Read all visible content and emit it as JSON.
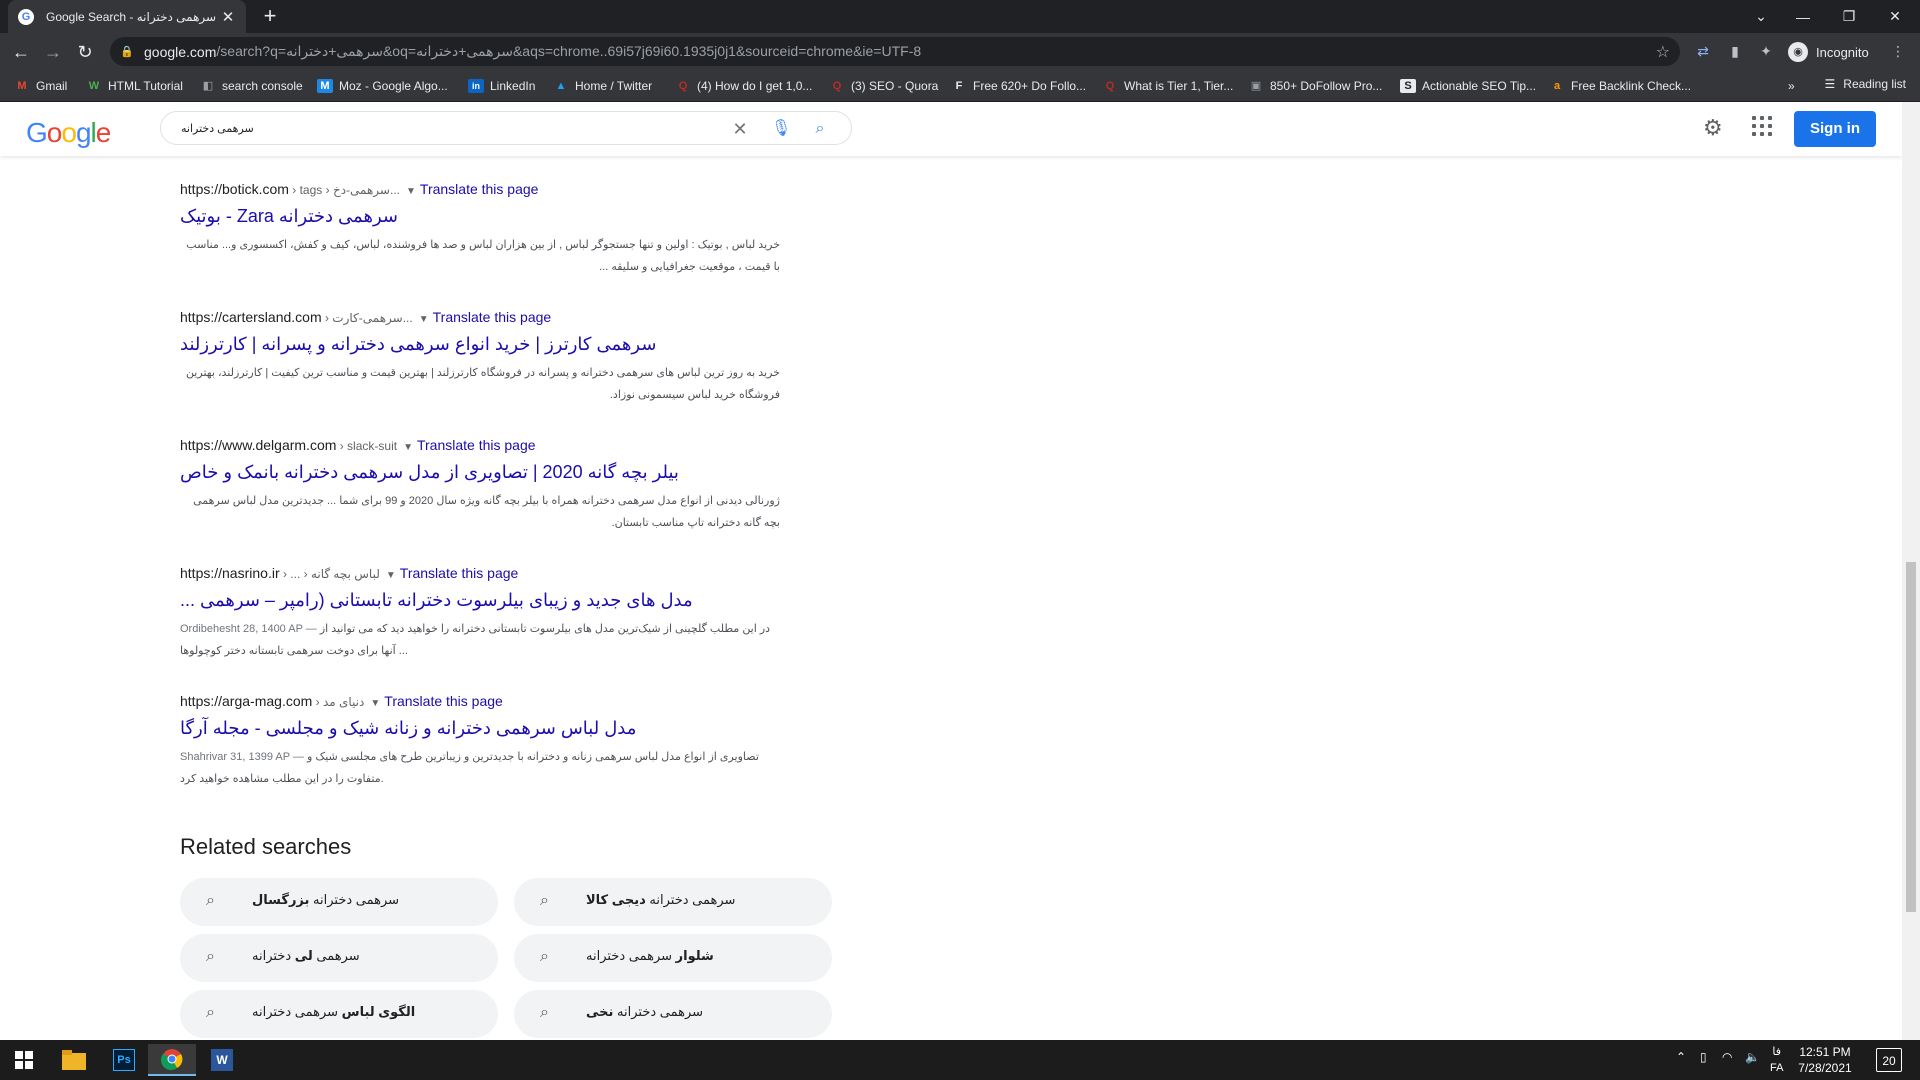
{
  "browser": {
    "tab_title": "Google Search - سرهمی دخترانه",
    "url_host": "google.com",
    "url_rest": "/search?q=سرهمی+دخترانه&oq=سرهمی+دخترانه&aqs=chrome..69i57j69i60.1935j0j1&sourceid=chrome&ie=UTF-8",
    "incognito_label": "Incognito",
    "reading_list": "Reading list",
    "bookmarks": [
      {
        "label": "Gmail",
        "icon": "M",
        "color": "#ea4335"
      },
      {
        "label": "HTML Tutorial",
        "icon": "W",
        "color": "#4caf50"
      },
      {
        "label": "search console",
        "icon": "◧",
        "color": "#9aa0a6"
      },
      {
        "label": "Moz - Google Algo...",
        "icon": "M",
        "color": "#1e88e5"
      },
      {
        "label": "LinkedIn",
        "icon": "in",
        "color": "#0a66c2"
      },
      {
        "label": "Home / Twitter",
        "icon": "🐦",
        "color": "#1da1f2"
      },
      {
        "label": "(4) How do I get 1,0...",
        "icon": "Q",
        "color": "#b92b27"
      },
      {
        "label": "(3) SEO - Quora",
        "icon": "Q",
        "color": "#b92b27"
      },
      {
        "label": "Free 620+ Do Follo...",
        "icon": "F",
        "color": "#e8eaed"
      },
      {
        "label": "What is Tier 1, Tier...",
        "icon": "Q",
        "color": "#b92b27"
      },
      {
        "label": "850+ DoFollow Pro...",
        "icon": "▣",
        "color": "#9aa0a6"
      },
      {
        "label": "Actionable SEO Tip...",
        "icon": "S",
        "color": "#e8eaed"
      },
      {
        "label": "Free Backlink Check...",
        "icon": "a",
        "color": "#ff9800"
      }
    ]
  },
  "google": {
    "query": "سرهمی دخترانه",
    "signin": "Sign in"
  },
  "results": [
    {
      "host": "https://botick.com",
      "path": " › tags › سرهمی-دخ...",
      "translate": "Translate this page",
      "title": "سرهمی دخترانه Zara - بوتیک",
      "snippet": "خرید لباس , بوتیک : اولین و تنها جستجوگر لباس , از بین هزاران لباس و صد ها فروشنده، لباس، کیف و کفش، اکسسوری و... مناسب با قیمت ، موقعیت جغرافیایی و سلیقه ..."
    },
    {
      "host": "https://cartersland.com",
      "path": " › سرهمی-کارت...",
      "translate": "Translate this page",
      "title": "سرهمی کارترز | خرید انواع سرهمی دخترانه و پسرانه | کارترزلند",
      "snippet": "خرید به روز ترین لباس های سرهمی دخترانه و پسرانه در فروشگاه کارترزلند | بهترین قیمت و مناسب ترین کیفیت | کارترزلند، بهترین فروشگاه خرید لباس سیسمونی نوزاد."
    },
    {
      "host": "https://www.delgarm.com",
      "path": " › slack-suit",
      "translate": "Translate this page",
      "title": "بیلر بچه گانه 2020 | تصاویری از مدل سرهمی دخترانه بانمک و خاص",
      "snippet": "ژورنالی دیدنی از انواع مدل سرهمی دخترانه همراه با بیلر بچه گانه ویژه سال 2020 و 99 برای شما ... جدیدترین مدل لباس سرهمی بچه گانه دخترانه تاپ مناسب تابستان."
    },
    {
      "host": "https://nasrino.ir",
      "path": " › ... › لباس بچه گانه",
      "translate": "Translate this page",
      "title": "مدل های جدید و زیبای بیلرسوت دخترانه تابستانی (رامپر – سرهمی ...",
      "date": "Ordibehesht 28, 1400 AP —",
      "snippet": "در این مطلب گلچینی از شیک‌ترین مدل های بیلرسوت تابستانی دخترانه را خواهید دید که می توانید از آنها برای دوخت سرهمی تابستانه دختر کوچولوها ..."
    },
    {
      "host": "https://arga-mag.com",
      "path": " › دنیای مد",
      "translate": "Translate this page",
      "title": "مدل لباس سرهمی دخترانه و زنانه شیک و مجلسی - مجله آرگا",
      "date": "Shahrivar 31, 1399 AP —",
      "snippet": "تصاویری از انواع مدل لباس سرهمی زنانه و دخترانه با جدیدترین و زیباترین طرح های مجلسی شیک و متفاوت را در این مطلب مشاهده خواهید کرد."
    }
  ],
  "related": {
    "title": "Related searches",
    "items": [
      {
        "plain": "سرهمی دخترانه ",
        "bold": "بزرگسال"
      },
      {
        "plain": "سرهمی دخترانه ",
        "bold": "دیجی کالا"
      },
      {
        "plain": "سرهمی ",
        "bold": "لی",
        "after": " دخترانه"
      },
      {
        "plain": "",
        "bold": "شلوار",
        "after": " سرهمی دخترانه"
      },
      {
        "plain": "",
        "bold": "الگوی لباس",
        "after": " سرهمی دخترانه"
      },
      {
        "plain": "سرهمی دخترانه ",
        "bold": "نخی"
      }
    ]
  },
  "taskbar": {
    "time": "12:51 PM",
    "date": "7/28/2021",
    "lang_top": "فا",
    "lang_bottom": "FA",
    "notif_count": "20"
  }
}
